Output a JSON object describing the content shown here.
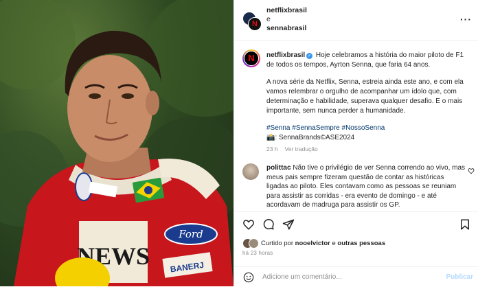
{
  "header": {
    "account_primary": "netflixbrasil",
    "connector": "e",
    "account_secondary": "sennabrasil",
    "more_label": "···",
    "avatar_letter": "N"
  },
  "caption": {
    "avatar_letter": "N",
    "username": "netflixbrasil",
    "verified": "✓",
    "intro": "Hoje celebramos a história do maior piloto de F1 de todos os tempos, Ayrton Senna, que faria 64 anos.",
    "paragraph": "A nova série da Netflix, Senna, estreia ainda este ano, e com ela vamos relembrar o orgulho de acompanhar um ídolo que, com determinação e habilidade, superava qualquer desafio. E o mais importante, sem nunca perder a humanidade.",
    "hashtags": "#Senna #SennaSempre #NossoSenna",
    "credit": "📸: SennaBrands©ASE2024",
    "age": "23 h",
    "translate_label": "Ver tradução"
  },
  "comment": {
    "username": "polittac",
    "text": "Não tive o privilégio de ver Senna correndo ao vivo, mas meus pais sempre fizeram questão de contar as históricas ligadas ao piloto. Eles contavam como as pessoas se reuniam para assistir as corridas - era evento de domingo - e até acordavam de madruga para assistir os GP."
  },
  "likes": {
    "prefix": "Curtido por",
    "user": "nooelvictor",
    "connector": "e",
    "others": "outras pessoas"
  },
  "timestamp": "há 23 horas",
  "add_comment": {
    "placeholder": "Adicione um comentário...",
    "post_label": "Publicar"
  },
  "photo": {
    "badge_ford": "Ford",
    "badge_banerj": "BANERJ",
    "suit_text": "NEWS"
  },
  "colors": {
    "brand_netflix": "#e50914",
    "link": "#00376b",
    "verified": "#3897f0",
    "post_disabled": "#b3dbff",
    "muted": "#8e8e8e"
  }
}
